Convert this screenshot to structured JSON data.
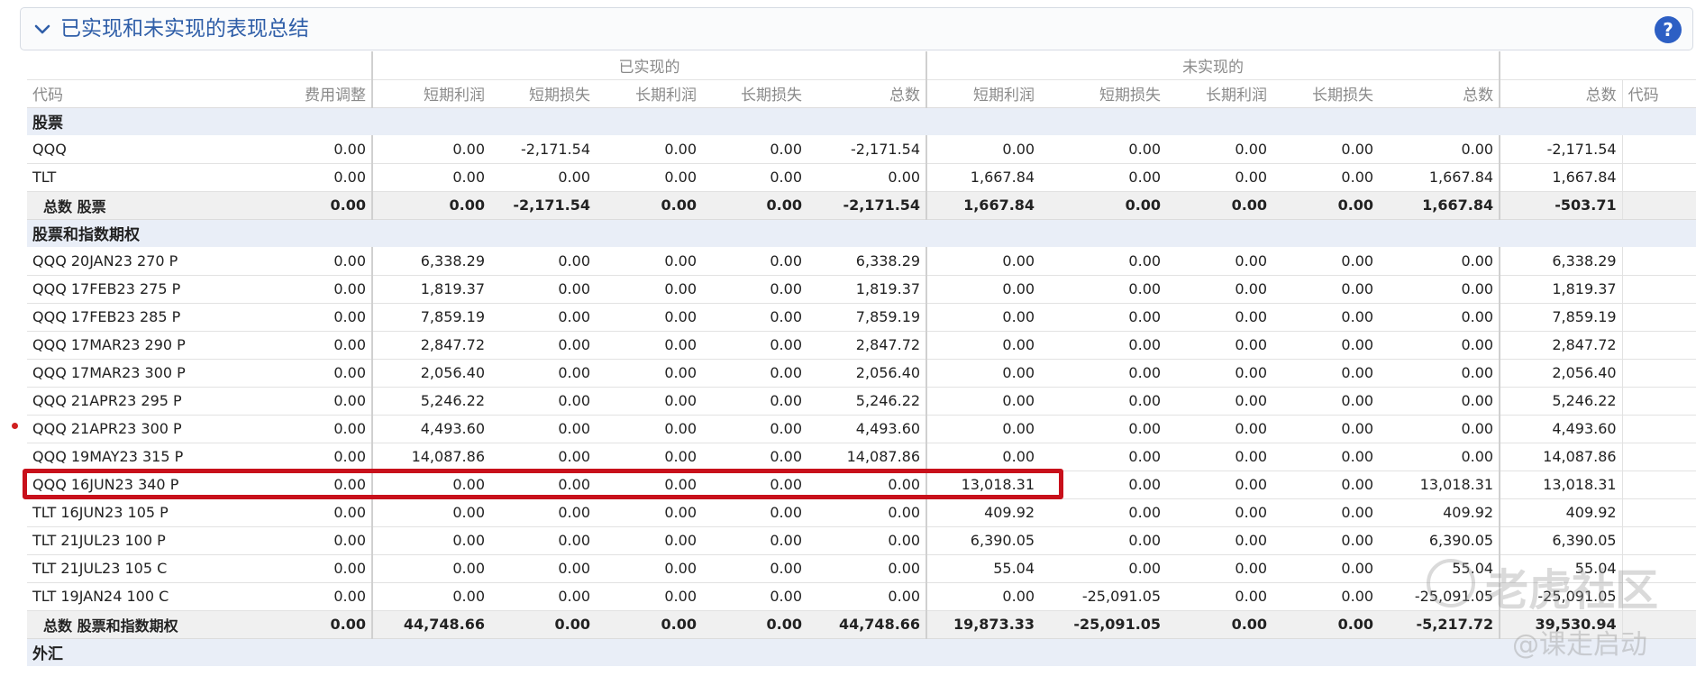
{
  "panel": {
    "title": "已实现和未实现的表现总结",
    "help_label": "?"
  },
  "groups": {
    "realized": "已实现的",
    "unrealized": "未实现的"
  },
  "columns": [
    "代码",
    "费用调整",
    "短期利润",
    "短期损失",
    "长期利润",
    "长期损失",
    "总数",
    "短期利润",
    "短期损失",
    "长期利润",
    "长期损失",
    "总数",
    "总数",
    "代码"
  ],
  "sections": [
    {
      "title": "股票",
      "rows": [
        [
          "QQQ",
          "0.00",
          "0.00",
          "-2,171.54",
          "0.00",
          "0.00",
          "-2,171.54",
          "0.00",
          "0.00",
          "0.00",
          "0.00",
          "0.00",
          "-2,171.54",
          ""
        ],
        [
          "TLT",
          "0.00",
          "0.00",
          "0.00",
          "0.00",
          "0.00",
          "0.00",
          "1,667.84",
          "0.00",
          "0.00",
          "0.00",
          "1,667.84",
          "1,667.84",
          ""
        ]
      ],
      "total": [
        "总数 股票",
        "0.00",
        "0.00",
        "-2,171.54",
        "0.00",
        "0.00",
        "-2,171.54",
        "1,667.84",
        "0.00",
        "0.00",
        "0.00",
        "1,667.84",
        "-503.71",
        ""
      ]
    },
    {
      "title": "股票和指数期权",
      "rows": [
        [
          "QQQ 20JAN23 270 P",
          "0.00",
          "6,338.29",
          "0.00",
          "0.00",
          "0.00",
          "6,338.29",
          "0.00",
          "0.00",
          "0.00",
          "0.00",
          "0.00",
          "6,338.29",
          ""
        ],
        [
          "QQQ 17FEB23 275 P",
          "0.00",
          "1,819.37",
          "0.00",
          "0.00",
          "0.00",
          "1,819.37",
          "0.00",
          "0.00",
          "0.00",
          "0.00",
          "0.00",
          "1,819.37",
          ""
        ],
        [
          "QQQ 17FEB23 285 P",
          "0.00",
          "7,859.19",
          "0.00",
          "0.00",
          "0.00",
          "7,859.19",
          "0.00",
          "0.00",
          "0.00",
          "0.00",
          "0.00",
          "7,859.19",
          ""
        ],
        [
          "QQQ 17MAR23 290 P",
          "0.00",
          "2,847.72",
          "0.00",
          "0.00",
          "0.00",
          "2,847.72",
          "0.00",
          "0.00",
          "0.00",
          "0.00",
          "0.00",
          "2,847.72",
          ""
        ],
        [
          "QQQ 17MAR23 300 P",
          "0.00",
          "2,056.40",
          "0.00",
          "0.00",
          "0.00",
          "2,056.40",
          "0.00",
          "0.00",
          "0.00",
          "0.00",
          "0.00",
          "2,056.40",
          ""
        ],
        [
          "QQQ 21APR23 295 P",
          "0.00",
          "5,246.22",
          "0.00",
          "0.00",
          "0.00",
          "5,246.22",
          "0.00",
          "0.00",
          "0.00",
          "0.00",
          "0.00",
          "5,246.22",
          ""
        ],
        [
          "QQQ 21APR23 300 P",
          "0.00",
          "4,493.60",
          "0.00",
          "0.00",
          "0.00",
          "4,493.60",
          "0.00",
          "0.00",
          "0.00",
          "0.00",
          "0.00",
          "4,493.60",
          ""
        ],
        [
          "QQQ 19MAY23 315 P",
          "0.00",
          "14,087.86",
          "0.00",
          "0.00",
          "0.00",
          "14,087.86",
          "0.00",
          "0.00",
          "0.00",
          "0.00",
          "0.00",
          "14,087.86",
          ""
        ],
        [
          "QQQ 16JUN23 340 P",
          "0.00",
          "0.00",
          "0.00",
          "0.00",
          "0.00",
          "0.00",
          "13,018.31",
          "0.00",
          "0.00",
          "0.00",
          "13,018.31",
          "13,018.31",
          ""
        ],
        [
          "TLT 16JUN23 105 P",
          "0.00",
          "0.00",
          "0.00",
          "0.00",
          "0.00",
          "0.00",
          "409.92",
          "0.00",
          "0.00",
          "0.00",
          "409.92",
          "409.92",
          ""
        ],
        [
          "TLT 21JUL23 100 P",
          "0.00",
          "0.00",
          "0.00",
          "0.00",
          "0.00",
          "0.00",
          "6,390.05",
          "0.00",
          "0.00",
          "0.00",
          "6,390.05",
          "6,390.05",
          ""
        ],
        [
          "TLT 21JUL23 105 C",
          "0.00",
          "0.00",
          "0.00",
          "0.00",
          "0.00",
          "0.00",
          "55.04",
          "0.00",
          "0.00",
          "0.00",
          "55.04",
          "55.04",
          ""
        ],
        [
          "TLT 19JAN24 100 C",
          "0.00",
          "0.00",
          "0.00",
          "0.00",
          "0.00",
          "0.00",
          "0.00",
          "-25,091.05",
          "0.00",
          "0.00",
          "-25,091.05",
          "-25,091.05",
          ""
        ]
      ],
      "total": [
        "总数 股票和指数期权",
        "0.00",
        "44,748.66",
        "0.00",
        "0.00",
        "0.00",
        "44,748.66",
        "19,873.33",
        "-25,091.05",
        "0.00",
        "0.00",
        "-5,217.72",
        "39,530.94",
        ""
      ]
    },
    {
      "title": "外汇",
      "rows": []
    }
  ],
  "watermark": {
    "name": "老虎社区",
    "author": "@课走启动"
  }
}
